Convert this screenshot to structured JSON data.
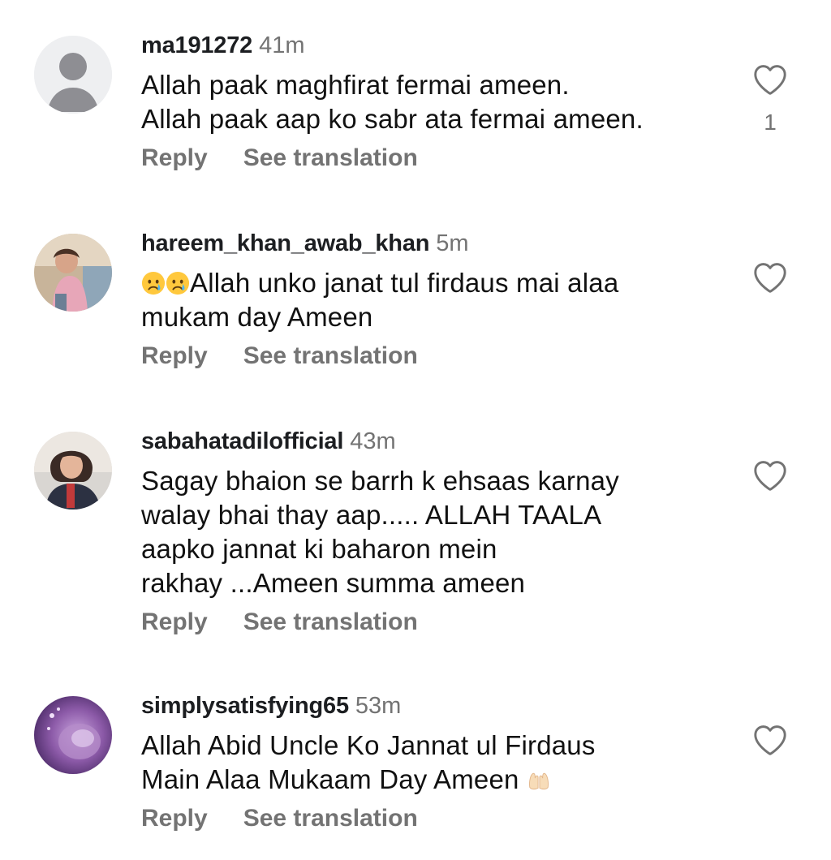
{
  "reply_label": "Reply",
  "translate_label": "See translation",
  "comments": [
    {
      "username": "ma191272",
      "time": "41m",
      "lines": [
        "Allah paak maghfirat fermai ameen.",
        "Allah paak aap ko sabr ata fermai ameen."
      ],
      "likes": "1",
      "avatar": "default-avatar"
    },
    {
      "username": "hareem_khan_awab_khan",
      "time": "5m",
      "lines": [
        "Allah unko janat tul firdaus  mai alaa",
        "mukam day Ameen"
      ],
      "likes": "",
      "avatar": "photo-child"
    },
    {
      "username": "sabahatadilofficial",
      "time": "43m",
      "lines": [
        "Sagay bhaion se barrh k ehsaas karnay",
        "walay bhai thay aap..... ALLAH TAALA",
        "aapko jannat ki baharon mein",
        "rakhay ...Ameen summa ameen"
      ],
      "likes": "",
      "avatar": "photo-woman"
    },
    {
      "username": "simplysatisfying65",
      "time": "53m",
      "lines": [
        "Allah Abid Uncle Ko Jannat ul Firdaus",
        "Main Alaa Mukaam Day Ameen"
      ],
      "likes": "",
      "avatar": "photo-purple"
    }
  ],
  "icons": {
    "like": "heart-outline-icon",
    "crying_emoji": "crying-face-emoji",
    "praying_emoji": "palms-up-together-emoji"
  },
  "colors": {
    "secondary_text": "#737373",
    "primary_text": "#111111"
  }
}
